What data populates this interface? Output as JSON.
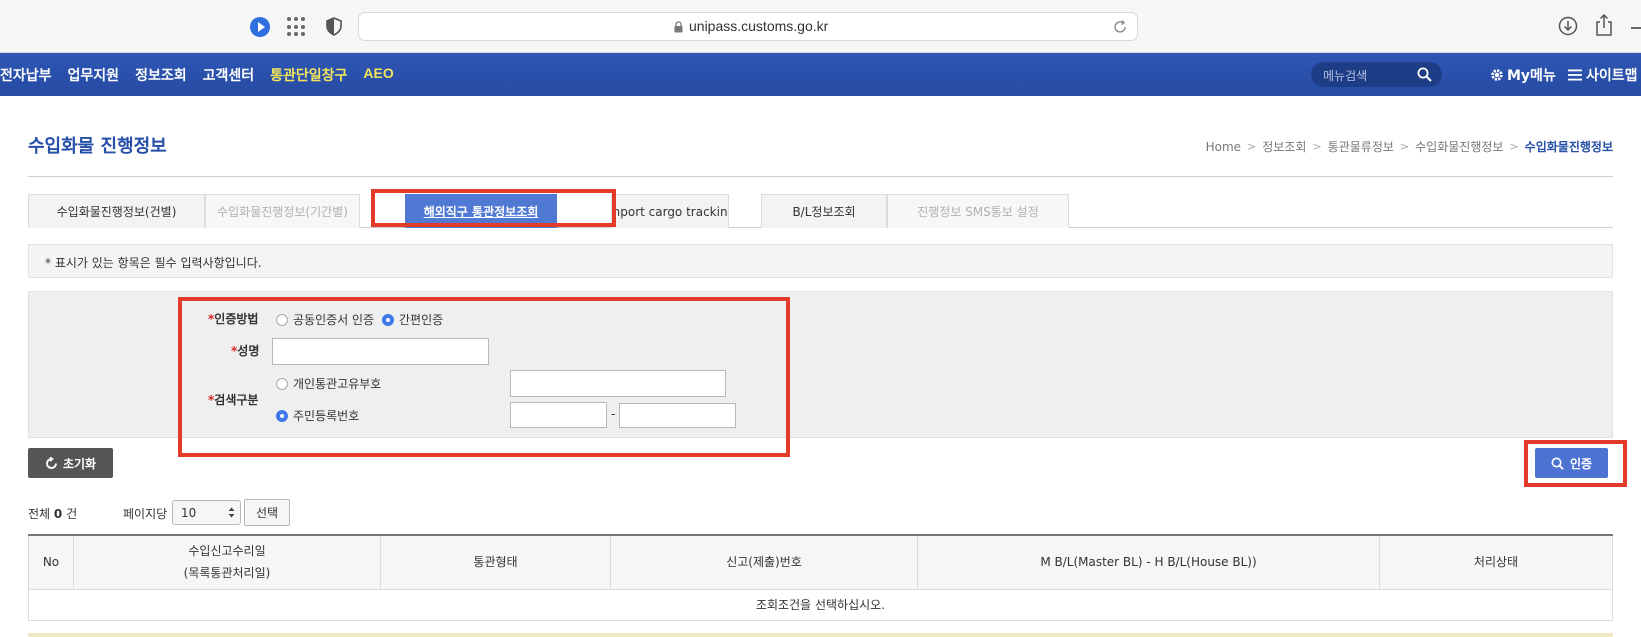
{
  "browser": {
    "url": "unipass.customs.go.kr"
  },
  "topnav": {
    "items": [
      {
        "label": "전자납부",
        "highlight": false
      },
      {
        "label": "업무지원",
        "highlight": false
      },
      {
        "label": "정보조회",
        "highlight": false
      },
      {
        "label": "고객센터",
        "highlight": false
      },
      {
        "label": "통관단일창구",
        "highlight": true
      },
      {
        "label": "AEO",
        "highlight": true
      }
    ],
    "search_placeholder": "메뉴검색",
    "mymenu_label": "My메뉴",
    "sitemap_label": "사이트맵"
  },
  "page": {
    "title": "수입화물 진행정보",
    "breadcrumb": [
      "Home",
      "정보조회",
      "통관물류정보",
      "수입화물진행정보",
      "수입화물진행정보"
    ]
  },
  "tabs": [
    {
      "label": "수입화물진행정보(건별)",
      "state": "normal"
    },
    {
      "label": "수입화물진행정보(기간별)",
      "state": "dim"
    },
    {
      "label": "해외직구 통관정보조회",
      "state": "active"
    },
    {
      "label": "Import cargo tracking",
      "state": "normal"
    },
    {
      "label": "B/L정보조회",
      "state": "normal"
    },
    {
      "label": "진행정보 SMS통보 설정",
      "state": "dim"
    }
  ],
  "notice": "* 표시가 있는 항목은 필수 입력사항입니다.",
  "form": {
    "auth_method": {
      "label": "인증방법",
      "options": [
        {
          "label": "공동인증서 인증",
          "selected": false
        },
        {
          "label": "간편인증",
          "selected": true
        }
      ]
    },
    "name": {
      "label": "성명",
      "value": ""
    },
    "search_type": {
      "label": "검색구분",
      "options": [
        {
          "label": "개인통관고유부호",
          "selected": false
        },
        {
          "label": "주민등록번호",
          "selected": true
        }
      ],
      "separator": "-"
    }
  },
  "buttons": {
    "reset": "초기화",
    "auth": "인증",
    "select": "선택"
  },
  "list": {
    "total_prefix": "전체",
    "total_count": "0",
    "total_suffix": "건",
    "per_page_label": "페이지당",
    "per_page_value": "10",
    "columns": [
      "No",
      "수입신고수리일",
      "(목록통관처리일)",
      "통관형태",
      "신고(제출)번호",
      "M B/L(Master BL) - H B/L(House BL))",
      "처리상태"
    ],
    "empty_message": "조회조건을 선택하십시오."
  },
  "colors": {
    "nav_bg": "#2e56b4",
    "accent": "#2650a8",
    "active_tab": "#4f79d3",
    "highlight_box": "#e23b2a",
    "required": "#d9261c"
  }
}
